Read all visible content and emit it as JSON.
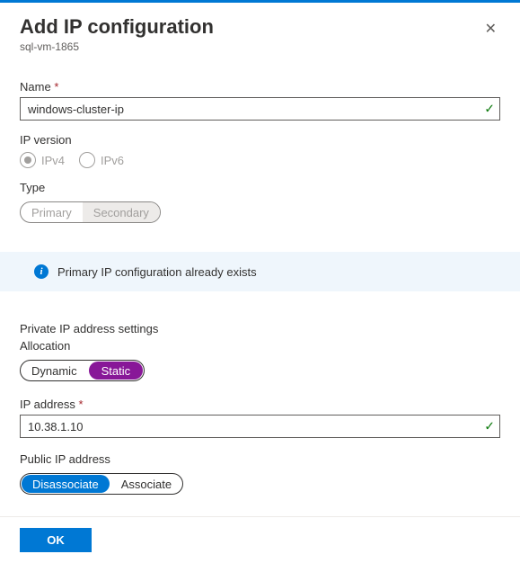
{
  "header": {
    "title": "Add IP configuration",
    "subtitle": "sql-vm-1865"
  },
  "name": {
    "label": "Name",
    "value": "windows-cluster-ip"
  },
  "ipVersion": {
    "label": "IP version",
    "options": {
      "ipv4": "IPv4",
      "ipv6": "IPv6"
    },
    "selected": "ipv4"
  },
  "type": {
    "label": "Type",
    "options": {
      "primary": "Primary",
      "secondary": "Secondary"
    }
  },
  "banner": {
    "text": "Primary IP configuration already exists"
  },
  "privateIp": {
    "sectionTitle": "Private IP address settings",
    "allocation": {
      "label": "Allocation",
      "options": {
        "dynamic": "Dynamic",
        "static": "Static"
      },
      "selected": "static"
    },
    "address": {
      "label": "IP address",
      "value": "10.38.1.10"
    }
  },
  "publicIp": {
    "label": "Public IP address",
    "options": {
      "disassociate": "Disassociate",
      "associate": "Associate"
    },
    "selected": "disassociate"
  },
  "footer": {
    "ok": "OK"
  }
}
